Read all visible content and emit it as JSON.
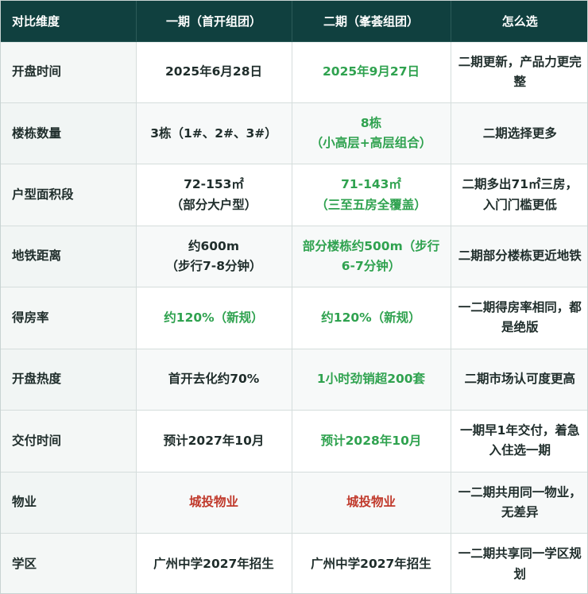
{
  "colors": {
    "header_bg": "#10403f",
    "header_text": "#ffffff",
    "green": "#2fa24f",
    "red": "#c0392b",
    "text": "#1f2d2b"
  },
  "headers": [
    "对比维度",
    "一期（首开组团）",
    "二期（峯荟组团）",
    "怎么选"
  ],
  "rows": [
    {
      "dimension": "开盘时间",
      "phase1": "2025年6月28日",
      "phase1_tone": "normal",
      "phase2": "2025年9月27日",
      "phase2_tone": "green",
      "choice": "二期更新，产品力更完整"
    },
    {
      "dimension": "楼栋数量",
      "phase1": "3栋（1#、2#、3#）",
      "phase1_tone": "normal",
      "phase2": "8栋\n（小高层+高层组合）",
      "phase2_tone": "green",
      "choice": "二期选择更多"
    },
    {
      "dimension": "户型面积段",
      "phase1": "72-153㎡\n（部分大户型）",
      "phase1_tone": "normal",
      "phase2": "71-143㎡\n（三至五房全覆盖）",
      "phase2_tone": "green",
      "choice": "二期多出71㎡三房，入门门槛更低"
    },
    {
      "dimension": "地铁距离",
      "phase1": "约600m\n（步行7-8分钟）",
      "phase1_tone": "normal",
      "phase2": "部分楼栋约500m（步行6-7分钟）",
      "phase2_tone": "green",
      "choice": "二期部分楼栋更近地铁"
    },
    {
      "dimension": "得房率",
      "phase1": "约120%（新规）",
      "phase1_tone": "green",
      "phase2": "约120%（新规）",
      "phase2_tone": "green",
      "choice": "一二期得房率相同，都是绝版"
    },
    {
      "dimension": "开盘热度",
      "phase1": "首开去化约70%",
      "phase1_tone": "normal",
      "phase2": "1小时劲销超200套",
      "phase2_tone": "green",
      "choice": "二期市场认可度更高"
    },
    {
      "dimension": "交付时间",
      "phase1": "预计2027年10月",
      "phase1_tone": "normal",
      "phase2": "预计2028年10月",
      "phase2_tone": "green",
      "choice": "一期早1年交付，着急入住选一期"
    },
    {
      "dimension": "物业",
      "phase1": "城投物业",
      "phase1_tone": "red",
      "phase2": "城投物业",
      "phase2_tone": "red",
      "choice": "一二期共用同一物业，无差异"
    },
    {
      "dimension": "学区",
      "phase1": "广州中学2027年招生",
      "phase1_tone": "normal",
      "phase2": "广州中学2027年招生",
      "phase2_tone": "normal",
      "choice": "一二期共享同一学区规划"
    }
  ]
}
